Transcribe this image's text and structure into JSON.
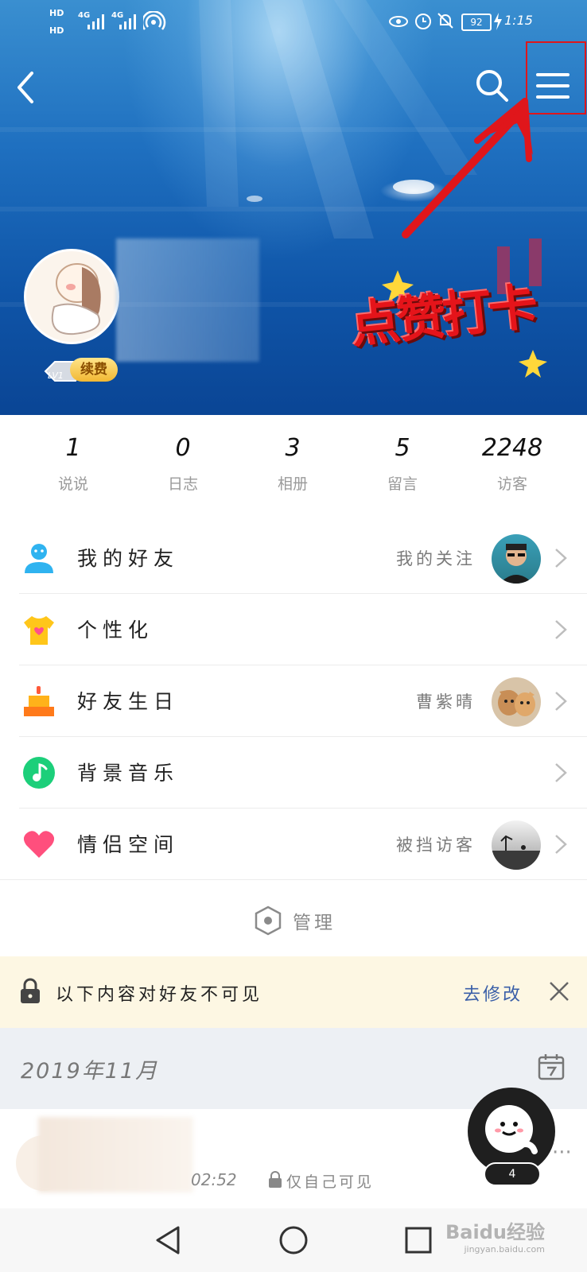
{
  "status_bar": {
    "hd1": "HD",
    "hd2": "HD",
    "net1": "4G",
    "net2": "4G",
    "battery": "92",
    "time": "1:15"
  },
  "header": {
    "back_icon": "back-chevron-icon",
    "search_icon": "search-icon",
    "menu_icon": "hamburger-menu-icon",
    "highlight_color": "#e0161b"
  },
  "profile": {
    "level": "LV1",
    "renew_label": "续费",
    "sticker_text": "点赞打卡"
  },
  "stats": [
    {
      "value": "1",
      "label": "说说"
    },
    {
      "value": "0",
      "label": "日志"
    },
    {
      "value": "3",
      "label": "相册"
    },
    {
      "value": "5",
      "label": "留言"
    },
    {
      "value": "2248",
      "label": "访客"
    }
  ],
  "menu_items": [
    {
      "label": "我的好友",
      "right_text": "我的关注",
      "icon": "friend-person-icon"
    },
    {
      "label": "个性化",
      "right_text": "",
      "icon": "tshirt-icon"
    },
    {
      "label": "好友生日",
      "right_text": "曹紫晴",
      "icon": "birthday-cake-icon"
    },
    {
      "label": "背景音乐",
      "right_text": "",
      "icon": "music-note-icon"
    },
    {
      "label": "情侣空间",
      "right_text": "被挡访客",
      "icon": "heart-icon"
    }
  ],
  "manage": {
    "label": "管理"
  },
  "notice": {
    "text": "以下内容对好友不可见",
    "action": "去修改"
  },
  "timeline": {
    "month": "2019年11月",
    "post_time": "02:52",
    "post_visibility": "仅自己可见",
    "fab_badge": "4"
  },
  "watermark": {
    "brand": "Baidu经验",
    "site": "jingyan.baidu.com"
  }
}
